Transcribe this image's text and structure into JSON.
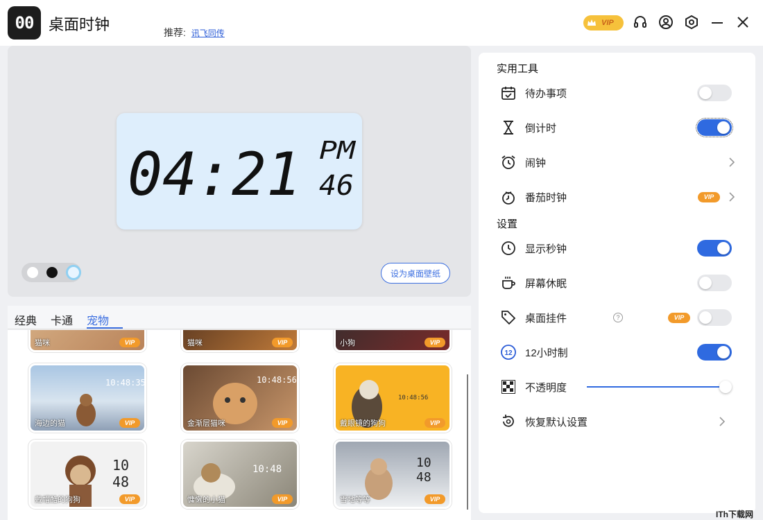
{
  "app": {
    "logo_text": "00",
    "title": "桌面时钟",
    "recommend_label": "推荐:",
    "recommend_link": "讯飞同传",
    "vip_label": "VIP"
  },
  "colors": {
    "accent": "#2f6ae0",
    "vip": "#f29a2a",
    "clock_card_bg": "#deeefc"
  },
  "clock": {
    "digits": "04:21",
    "ampm": "PM",
    "seconds": "46"
  },
  "preview": {
    "wallpaper_button": "设为桌面壁纸",
    "swatches": [
      "white",
      "black",
      "light-blue"
    ],
    "selected_swatch": "light-blue"
  },
  "tabs": [
    {
      "label": "经典",
      "active": false
    },
    {
      "label": "卡通",
      "active": false
    },
    {
      "label": "宠物",
      "active": true
    }
  ],
  "gallery": {
    "cards": [
      {
        "label": "猫咪",
        "vip": "VIP",
        "clock": ""
      },
      {
        "label": "猫咪",
        "vip": "VIP",
        "clock": ""
      },
      {
        "label": "小狗",
        "vip": "VIP",
        "clock": ""
      },
      {
        "label": "海边的猫",
        "vip": "VIP",
        "clock": "10:48:35"
      },
      {
        "label": "金渐层猫咪",
        "vip": "VIP",
        "clock": "10:48:56"
      },
      {
        "label": "戴眼镜的狗狗",
        "vip": "VIP",
        "clock": "10:48:56"
      },
      {
        "label": "戴帽酷的狗狗",
        "vip": "VIP",
        "clock": "10 48"
      },
      {
        "label": "慵懒的小猫",
        "vip": "VIP",
        "clock": "10:48"
      },
      {
        "label": "雪地等等",
        "vip": "VIP",
        "clock": "10 48"
      }
    ]
  },
  "settings": {
    "tools_title": "实用工具",
    "settings_title": "设置",
    "todo": {
      "label": "待办事项",
      "on": false
    },
    "countdown": {
      "label": "倒计时",
      "on": true
    },
    "alarm": {
      "label": "闹钟"
    },
    "pomodoro": {
      "label": "番茄时钟",
      "vip": "VIP"
    },
    "show_seconds": {
      "label": "显示秒钟",
      "on": true
    },
    "screen_sleep": {
      "label": "屏幕休眠",
      "on": false
    },
    "desktop_widget": {
      "label": "桌面挂件",
      "vip": "VIP",
      "help": "?",
      "on": false
    },
    "hour12": {
      "label": "12小时制",
      "on": true
    },
    "opacity": {
      "label": "不透明度",
      "value": 1.0
    },
    "restore": {
      "label": "恢复默认设置"
    }
  },
  "watermark": "ITh下载网"
}
